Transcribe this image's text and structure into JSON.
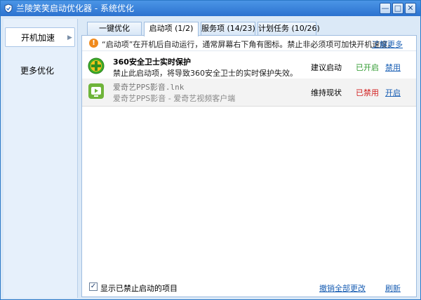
{
  "window": {
    "title": "兰陵笑笑启动优化器 - 系统优化"
  },
  "title_buttons": {
    "minimize": "—",
    "maximize": "□",
    "close": "✕"
  },
  "sidebar": {
    "items": [
      {
        "label": "开机加速",
        "arrow": "▶"
      },
      {
        "label": "更多优化"
      }
    ]
  },
  "tabs": [
    {
      "label": "一键优化"
    },
    {
      "label": "启动项 (1/2)"
    },
    {
      "label": "服务项 (14/23)"
    },
    {
      "label": "计划任务 (10/26)"
    }
  ],
  "notice": {
    "icon": "!",
    "text": "“启动项”在开机后自动运行，通常屏幕右下角有图标。禁止非必须项可加快开机速度。",
    "link": "了解更多"
  },
  "items": [
    {
      "name": "360安全卫士实时保护",
      "description": "禁止此启动项，将导致360安全卫士的实时保护失效。",
      "advice": "建议启动",
      "status": "已开启",
      "action": "禁用"
    },
    {
      "name": "爱奇艺PPS影音.lnk",
      "description": "爱奇艺PPS影音 - 爱奇艺视频客户端",
      "advice": "维持现状",
      "status": "已禁用",
      "action": "开启"
    }
  ],
  "footer": {
    "checkbox_checked": true,
    "checkbox_mark": "✓",
    "checkbox_label": "显示已禁止启动的项目",
    "revert_link": "撤销全部更改",
    "refresh_link": "刷新"
  },
  "colors": {
    "accent": "#2c72cf",
    "enabled": "#2f9a2f",
    "disabled": "#d21f1f",
    "link": "#1a5fb4"
  }
}
